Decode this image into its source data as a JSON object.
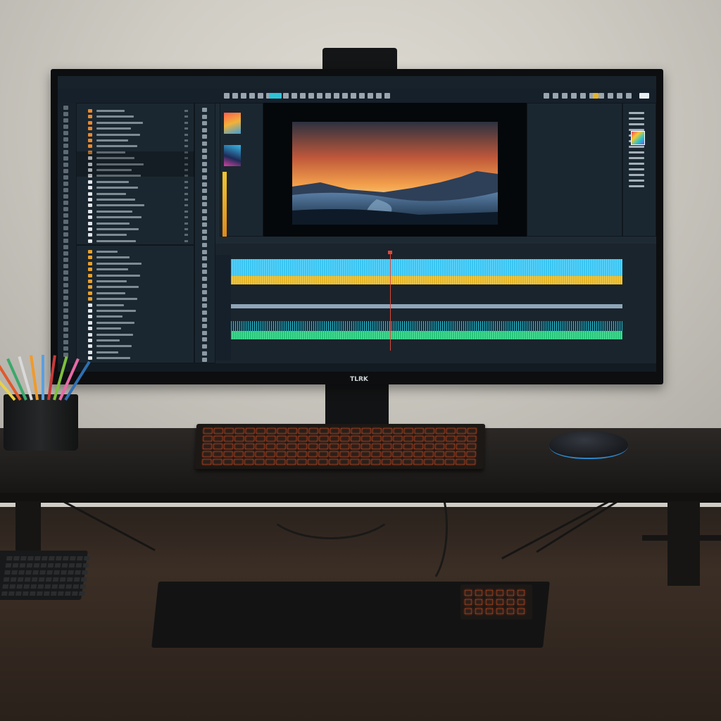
{
  "scene": {
    "description_label": "",
    "monitor": {
      "brand": "TLRK"
    },
    "software": {
      "type": "video-editor",
      "accent_color": "#2ec4d4",
      "waveform_colors": [
        "#39c4f0",
        "#e4b526",
        "#27c47a"
      ],
      "playhead_color": "#d9473b"
    },
    "keyboard": {
      "backlight_color": "#ff5a24"
    },
    "mouse": {
      "accent_color": "#2d86c9"
    }
  }
}
